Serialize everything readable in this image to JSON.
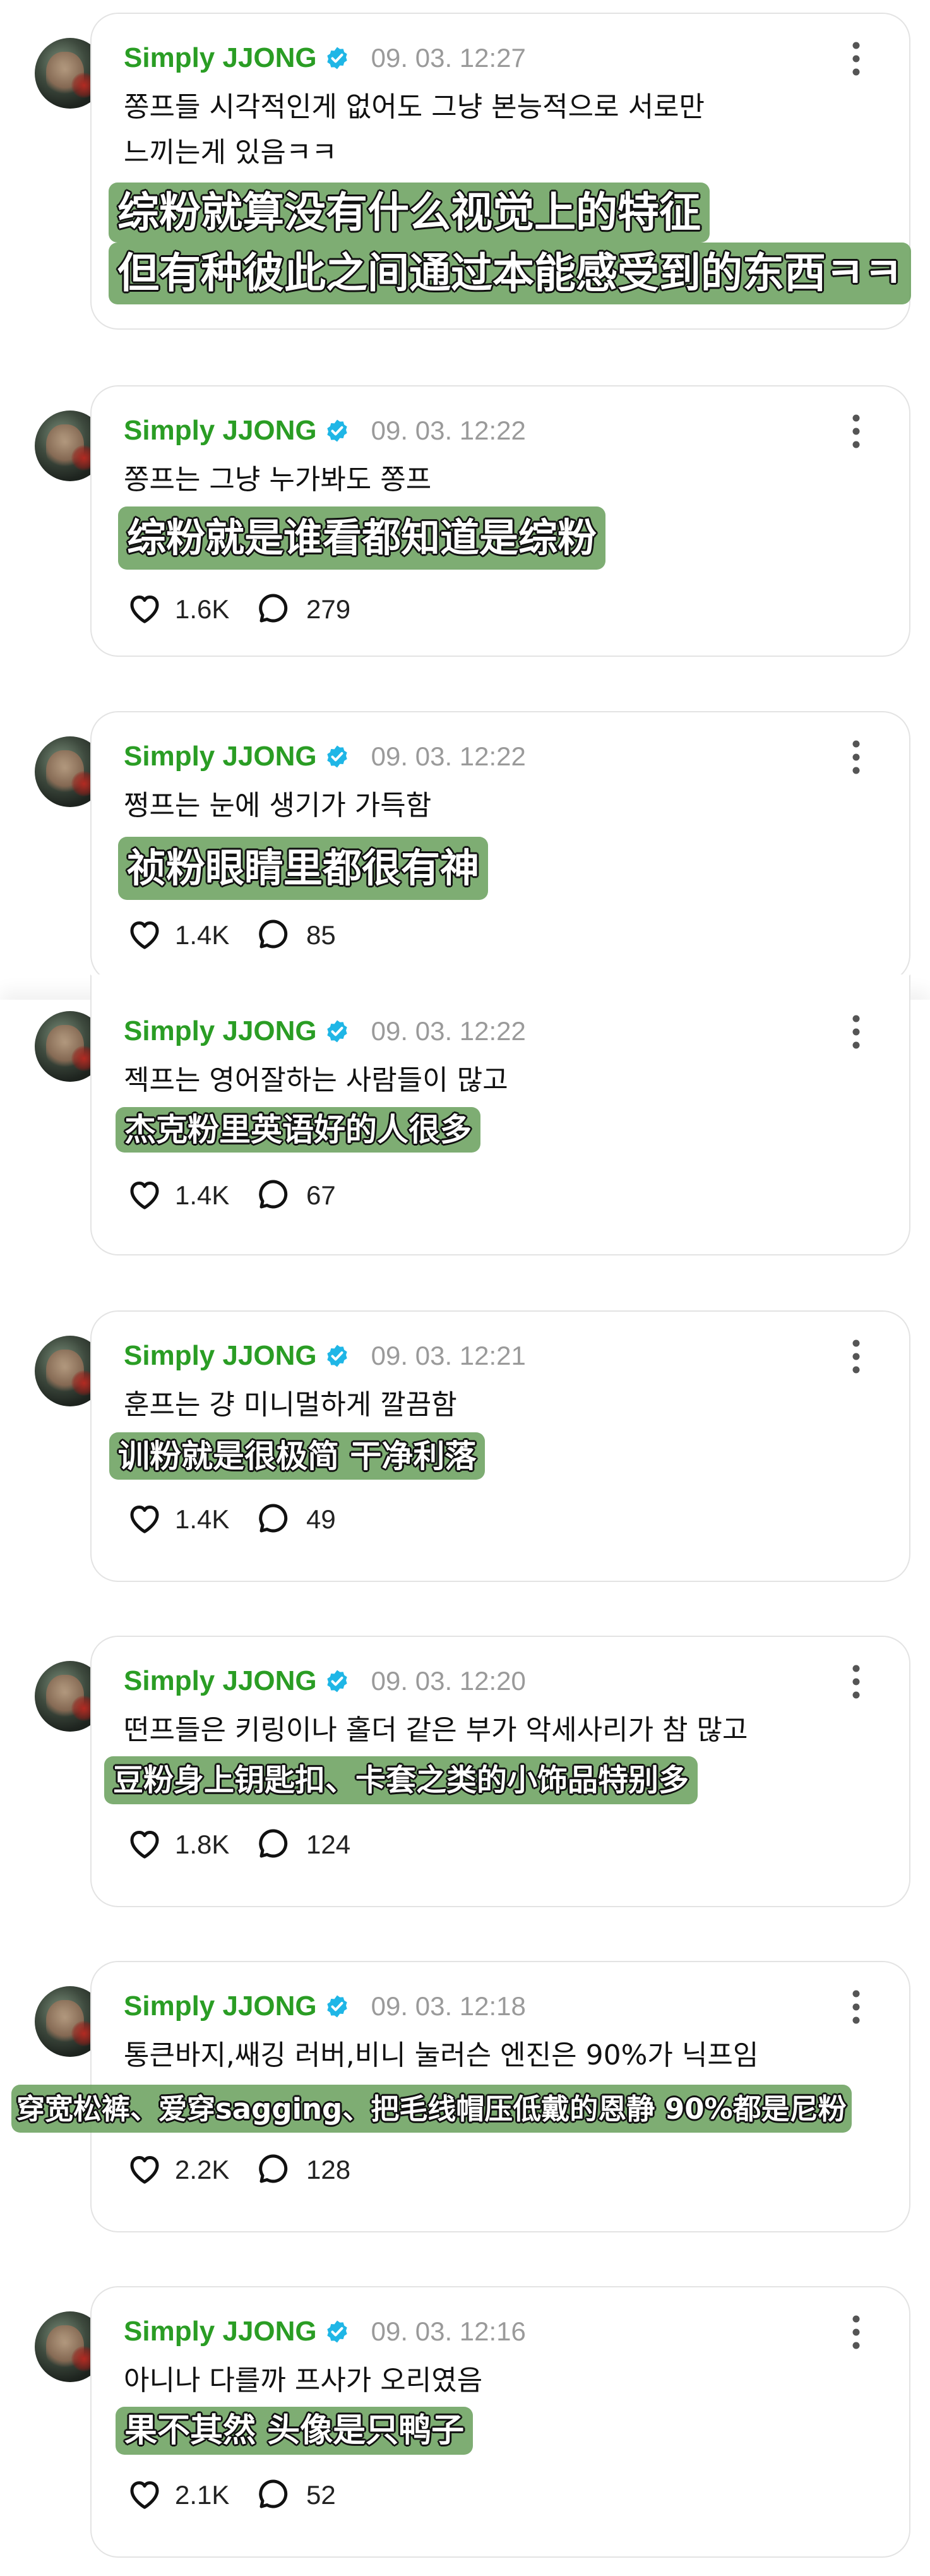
{
  "posts": [
    {
      "username": "Simply JJONG",
      "time": "09. 03. 12:27",
      "text_lines": [
        "쫑프들 시각적인게 없어도 그냥 본능적으로 서로만",
        "느끼는게 있음ㅋㅋ"
      ],
      "subtitle_lines": [
        "综粉就算没有什么视觉上的特征",
        "但有种彼此之间通过本能感受到的东西ㅋㅋ"
      ]
    },
    {
      "username": "Simply JJONG",
      "time": "09. 03. 12:22",
      "text_lines": [
        "쫑프는 그냥 누가봐도 쫑프"
      ],
      "subtitle_lines": [
        "综粉就是谁看都知道是综粉"
      ],
      "likes": "1.6K",
      "replies": "279"
    },
    {
      "username": "Simply JJONG",
      "time": "09. 03. 12:22",
      "text_lines": [
        "쩡프는 눈에 생기가 가득함"
      ],
      "subtitle_lines": [
        "祯粉眼睛里都很有神"
      ],
      "likes": "1.4K",
      "replies": "85"
    },
    {
      "username": "Simply JJONG",
      "time": "09. 03. 12:22",
      "text_lines": [
        "젝프는 영어잘하는 사람들이 많고"
      ],
      "subtitle_lines": [
        "杰克粉里英语好的人很多"
      ],
      "likes": "1.4K",
      "replies": "67"
    },
    {
      "username": "Simply JJONG",
      "time": "09. 03. 12:21",
      "text_lines": [
        "훈프는 걍 미니멀하게 깔끔함"
      ],
      "subtitle_lines": [
        "训粉就是很极简 干净利落"
      ],
      "likes": "1.4K",
      "replies": "49"
    },
    {
      "username": "Simply JJONG",
      "time": "09. 03. 12:20",
      "text_lines": [
        "떤프들은 키링이나 홀더 같은 부가 악세사리가 참 많고"
      ],
      "subtitle_lines": [
        "豆粉身上钥匙扣、卡套之类的小饰品特别多"
      ],
      "likes": "1.8K",
      "replies": "124"
    },
    {
      "username": "Simply JJONG",
      "time": "09. 03. 12:18",
      "text_lines": [
        "통큰바지,쌔깅 러버,비니 눌러슨 엔진은 90%가 닉프임"
      ],
      "subtitle_lines": [
        "穿宽松裤、爱穿sagging、把毛线帽压低戴的恩静 90%都是尼粉"
      ],
      "likes": "2.2K",
      "replies": "128"
    },
    {
      "username": "Simply JJONG",
      "time": "09. 03. 12:16",
      "text_lines": [
        "아니나 다를까 프사가 오리였음"
      ],
      "subtitle_lines": [
        "果不其然 头像是只鸭子"
      ],
      "likes": "2.1K",
      "replies": "52"
    }
  ],
  "icons": {
    "verified": "verified-badge-icon",
    "more": "more-vertical-icon",
    "like": "heart-icon",
    "reply": "comment-bubble-icon"
  },
  "colors": {
    "username": "#2a9d24",
    "verified": "#1fb6e6",
    "timestamp": "#9a9a9a",
    "subtitle_bg": "#69a05c",
    "card_border": "#e3e3e3"
  }
}
